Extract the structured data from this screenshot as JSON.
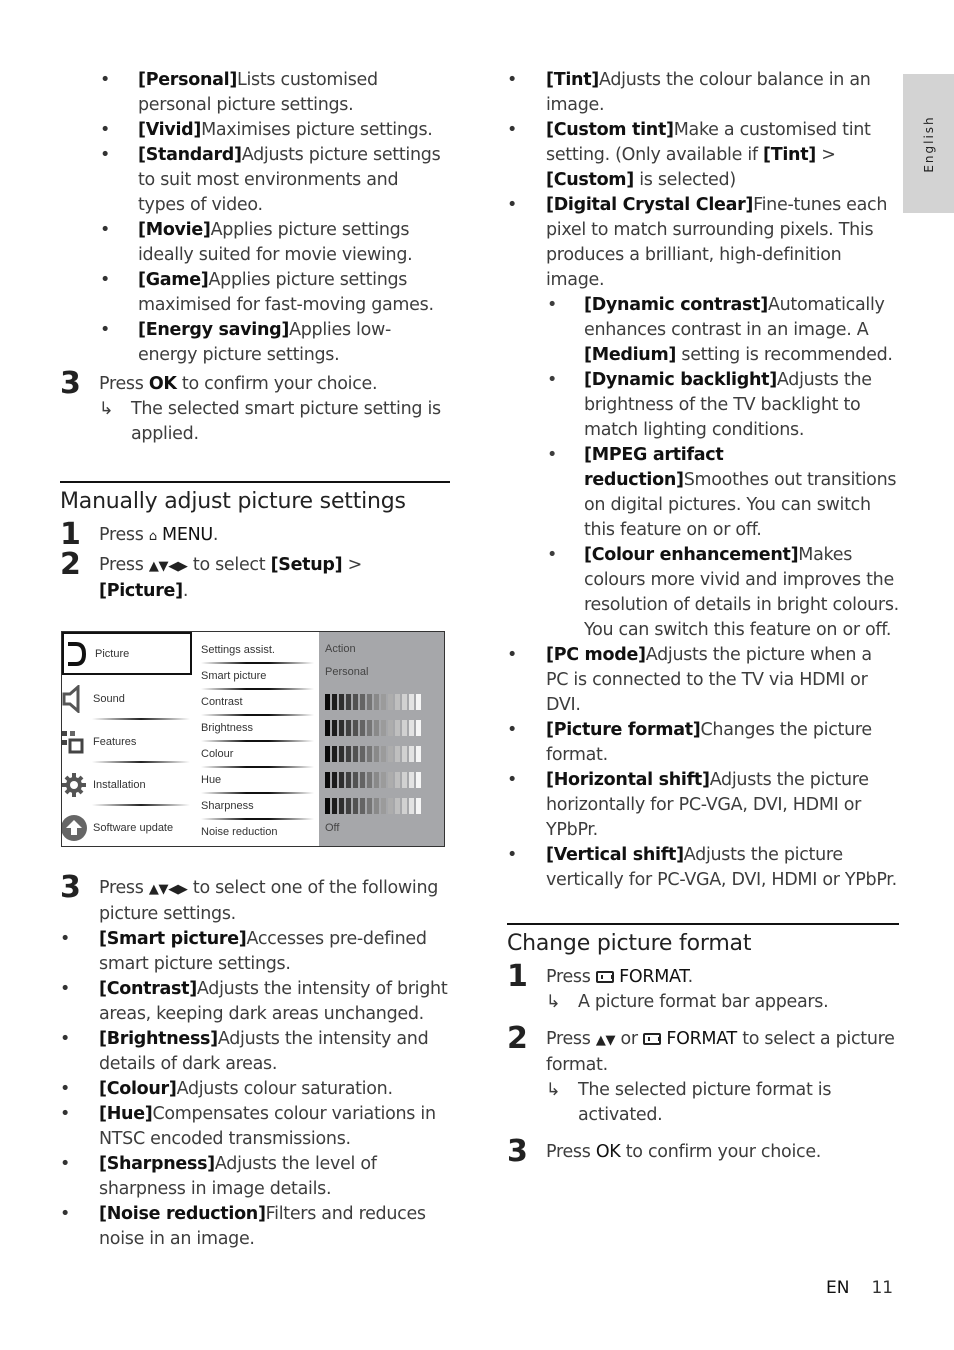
{
  "side_tab": {
    "label": "English"
  },
  "left": {
    "smart_items": [
      {
        "term": "[Personal]",
        "desc": "Lists customised personal picture settings."
      },
      {
        "term": "[Vivid]",
        "desc": "Maximises picture settings."
      },
      {
        "term": "[Standard]",
        "desc": "Adjusts picture settings to suit most environments and types of video."
      },
      {
        "term": "[Movie]",
        "desc": "Applies picture settings ideally suited for movie viewing."
      },
      {
        "term": "[Game]",
        "desc": "Applies picture settings maximised for fast-moving games."
      },
      {
        "term": "[Energy saving]",
        "desc": "Applies low-energy picture settings."
      }
    ],
    "step3_num": "3",
    "step3_pre": "Press ",
    "step3_key": "OK",
    "step3_post": " to confirm your choice.",
    "step3_result": "The selected smart picture setting is applied.",
    "section_title": "Manually adjust picture settings",
    "s1_num": "1",
    "s1_pre": "Press ",
    "s1_key": "MENU",
    "s1_post": ".",
    "s2_num": "2",
    "s2_pre": "Press ",
    "s2_arrows": "▲▼◀▶",
    "s2_mid": " to select ",
    "s2_t1": "[Setup]",
    "s2_gt": " > ",
    "s2_t2": "[Picture]",
    "s2_post": ".",
    "s3_num": "3",
    "s3_pre": "Press ",
    "s3_arrows": "▲▼◀▶",
    "s3_post": " to select one of the following picture settings.",
    "setting_items": [
      {
        "term": "[Smart picture]",
        "desc": "Accesses pre-defined smart picture settings."
      },
      {
        "term": "[Contrast]",
        "desc": "Adjusts the intensity of bright areas, keeping dark areas unchanged."
      },
      {
        "term": "[Brightness]",
        "desc": "Adjusts the intensity and details of dark areas."
      },
      {
        "term": "[Colour]",
        "desc": "Adjusts colour saturation."
      },
      {
        "term": "[Hue]",
        "desc": "Compensates colour variations in NTSC encoded transmissions."
      },
      {
        "term": "[Sharpness]",
        "desc": "Adjusts the level of sharpness in image details."
      },
      {
        "term": "[Noise reduction]",
        "desc": "Filters and reduces noise in an image."
      }
    ]
  },
  "tv_menu": {
    "main": [
      "Picture",
      "Sound",
      "Features",
      "Installation",
      "Software update"
    ],
    "main_icons": [
      "picture-icon",
      "sound-icon",
      "features-icon",
      "installation-gear-icon",
      "software-update-icon"
    ],
    "selected": "Picture",
    "sub": [
      "Settings assist.",
      "Smart picture",
      "Contrast",
      "Brightness",
      "Colour",
      "Hue",
      "Sharpness",
      "Noise reduction"
    ],
    "values": {
      "settings_assist": "Action",
      "smart_picture": "Personal",
      "noise_reduction": "Off"
    },
    "slider_levels": {
      "contrast": 1.0,
      "brightness": 1.0,
      "colour": 1.0,
      "hue": 1.0,
      "sharpness": 1.0
    },
    "slider_bars": 14
  },
  "right": {
    "items": [
      {
        "term": "[Tint]",
        "desc": "Adjusts the colour balance in an image."
      },
      {
        "term": "[Custom tint]",
        "desc": "Make a customised tint setting. (Only available if ",
        "t2": "[Tint]",
        "mid": " > ",
        "t3": "[Custom]",
        "end": " is selected)"
      },
      {
        "term": "[Digital Crystal Clear]",
        "desc": "Fine-tunes each pixel to match surrounding pixels. This produces a brilliant, high-definition image."
      }
    ],
    "dcc_sub": [
      {
        "term": "[Dynamic contrast]",
        "desc": "Automatically enhances contrast in an image. A ",
        "t2": "[Medium]",
        "end": " setting is recommended."
      },
      {
        "term": "[Dynamic backlight]",
        "desc": "Adjusts the brightness of the TV backlight to match lighting conditions."
      },
      {
        "term": "[MPEG artifact reduction]",
        "desc": "Smoothes out transitions on digital pictures. You can switch this feature on or off."
      },
      {
        "term": "[Colour enhancement]",
        "desc": "Makes colours more vivid and improves the resolution of details in bright colours. You can switch this feature on or off."
      }
    ],
    "items2": [
      {
        "term": "[PC mode]",
        "desc": "Adjusts the picture when a PC is connected to the TV via HDMI or DVI."
      },
      {
        "term": "[Picture format]",
        "desc": "Changes the picture format."
      },
      {
        "term": "[Horizontal shift]",
        "desc": "Adjusts the picture horizontally for PC-VGA, DVI, HDMI or YPbPr."
      },
      {
        "term": "[Vertical shift]",
        "desc": "Adjusts the picture vertically for PC-VGA, DVI, HDMI or YPbPr."
      }
    ],
    "section_title": "Change picture format",
    "f1_num": "1",
    "f1_pre": "Press ",
    "f1_key": "FORMAT",
    "f1_post": ".",
    "f1_result": "A picture format bar appears.",
    "f2_num": "2",
    "f2_pre": "Press ",
    "f2_arrows": "▲▼",
    "f2_or": " or ",
    "f2_key": "FORMAT",
    "f2_post": " to select a picture format.",
    "f2_result": "The selected picture format is activated.",
    "f3_num": "3",
    "f3_pre": "Press ",
    "f3_key": "OK",
    "f3_post": " to confirm your choice."
  },
  "footer": {
    "lang": "EN",
    "page": "11"
  },
  "result_arrow": "↳"
}
